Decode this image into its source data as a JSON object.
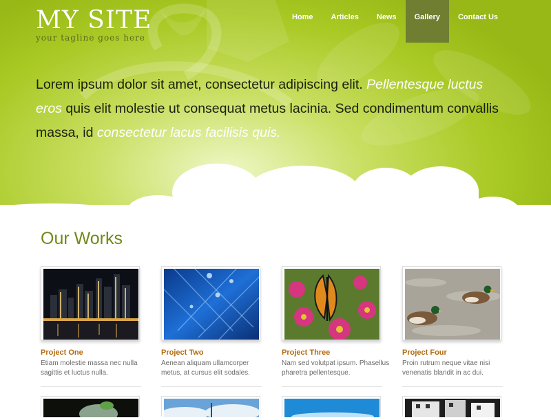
{
  "site": {
    "title": "MY SITE",
    "tagline": "your tagline goes here"
  },
  "nav": {
    "items": [
      {
        "label": "Home",
        "active": false
      },
      {
        "label": "Articles",
        "active": false
      },
      {
        "label": "News",
        "active": false
      },
      {
        "label": "Gallery",
        "active": true
      },
      {
        "label": "Contact Us",
        "active": false
      }
    ]
  },
  "intro": {
    "part1": "Lorem ipsum dolor sit amet, consectetur adipiscing elit.",
    "part2_italic": "Pellentesque luctus eros",
    "part3": "quis elit molestie ut consequat metus lacinia. Sed condimentum convallis massa, id",
    "part4_italic": "consectetur lacus facilisis quis."
  },
  "works": {
    "heading": "Our Works",
    "projects": [
      {
        "title": "Project One",
        "description": "Etiam molestie massa nec nulla sagittis et luctus nulla.",
        "image": "city-skyline-night"
      },
      {
        "title": "Project Two",
        "description": "Aenean aliquam ullamcorper metus, at cursus elit sodales.",
        "image": "blue-water-drops"
      },
      {
        "title": "Project Three",
        "description": "Nam sed volutpat ipsum. Phasellus pharetra pellentesque.",
        "image": "butterfly-on-flower"
      },
      {
        "title": "Project Four",
        "description": "Proin rutrum neque vitae nisi venenatis blandit in ac dui.",
        "image": "ducks-swimming"
      }
    ],
    "second_row_images": [
      "dark-plant",
      "sky-clouds",
      "blue-sky",
      "monochrome-building"
    ]
  },
  "colors": {
    "header_green": "#a9c924",
    "nav_active": "#6f7e31",
    "heading_green": "#6e8a18",
    "project_title_orange": "#b36a0f"
  }
}
